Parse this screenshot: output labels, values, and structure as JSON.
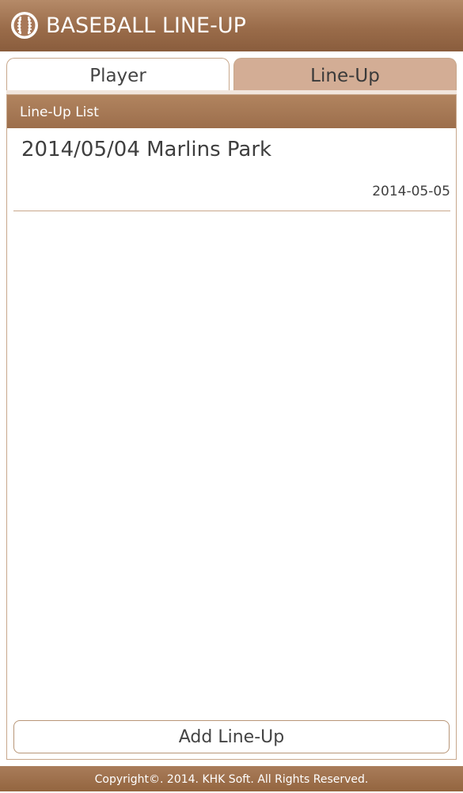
{
  "app": {
    "title": "BASEBALL LINE-UP",
    "icon": "baseball-icon"
  },
  "tabs": [
    {
      "label": "Player",
      "selected": false
    },
    {
      "label": "Line-Up",
      "selected": true
    }
  ],
  "panel": {
    "header": "Line-Up List",
    "items": [
      {
        "title": "2014/05/04 Marlins Park",
        "date": "2014-05-05"
      }
    ]
  },
  "actions": {
    "add_label": "Add Line-Up"
  },
  "footer": {
    "text": "Copyright©. 2014. KHK Soft. All Rights Reserved."
  },
  "colors": {
    "brand_brown": "#9a6c4a",
    "selected_tab": "#d3ad95",
    "border": "#c8a88c"
  }
}
